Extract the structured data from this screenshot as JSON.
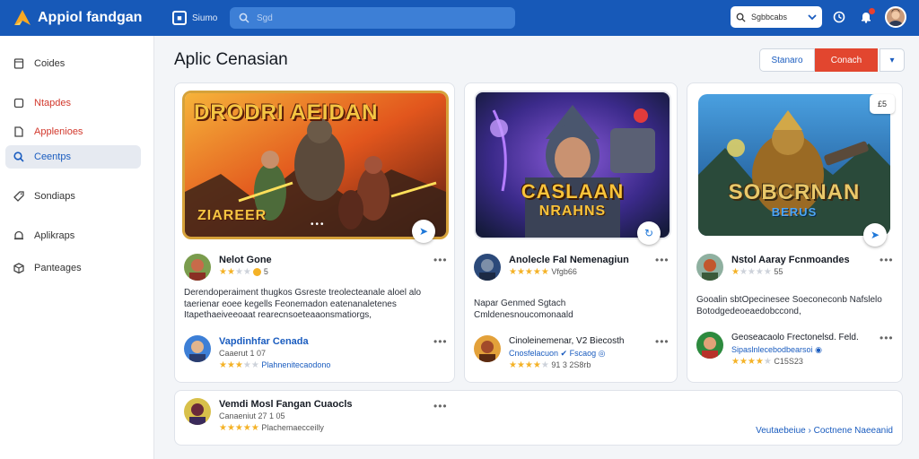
{
  "header": {
    "app_title": "Appiol fandgan",
    "switch_label": "Siumo",
    "search_placeholder": "Sgd",
    "select_label": "Sgbbcabs",
    "colors": {
      "bar": "#1759b8",
      "accent": "#e2462f",
      "link": "#1a5cbf"
    }
  },
  "sidebar": {
    "items": [
      {
        "label": "Coides",
        "icon": "bookmark-icon"
      },
      {
        "label": "Ntapdes",
        "icon": "square-icon"
      },
      {
        "label": "Applenioes",
        "icon": "file-icon"
      },
      {
        "label": "Ceentps",
        "icon": "search-icon"
      },
      {
        "label": "Sondiaps",
        "icon": "tag-icon"
      },
      {
        "label": "Aplikraps",
        "icon": "bell-icon"
      },
      {
        "label": "Panteages",
        "icon": "package-icon"
      }
    ]
  },
  "main": {
    "title": "Aplic Cenasian",
    "buttons": {
      "primary": "Stanaro",
      "accent": "Conach",
      "caret": "▾"
    },
    "cards": [
      {
        "thumb_title_top": "DRODRI AEIDAN",
        "thumb_title_bottom": "ZIAREER",
        "author": "Nelot Gone",
        "rating": 2,
        "desc": [
          "Derendoperaiment thugkos Gsreste treolecteanale aloel alo",
          "taerienar eoee kegells Feonemadon eatenanaletenes",
          "Itapethaeiveeoaat rearecnsoeteaaonsmatiorgs,"
        ],
        "reviewer": "Vapdinhfar Cenada",
        "reviewer_sub": "Caaerut 1  07",
        "reviewer_stars": 3,
        "reviewer_link": "Plahnenitecaodono"
      },
      {
        "thumb_title_top": "CASLAAN",
        "thumb_title_bottom": "NRAHNS",
        "author": "Anolecle Fal Nemenagiun",
        "rating": 5,
        "rating_text": "Vfgb66",
        "desc": [
          "Napar Genmed Sgtach",
          "Cmldenesnoucomonaald"
        ],
        "reviewer": "Cinoleinemenar, V2 Biecosth",
        "reviewer_sub": "Cnosfelacuon ✔ Fscaog ◎",
        "reviewer_stars": 4,
        "reviewer_link": "91 3 2S8rb"
      },
      {
        "thumb_title_top": "SOBCRNAN",
        "thumb_title_bottom": "BERUS",
        "corner_badge": "£5",
        "author": "Nstol Aaray Fcnmoandes",
        "rating": 1,
        "rating_text": "55",
        "desc": [
          "Gooalin sbtOpecinesee  Soeconeconb Nafslelo",
          "Botodgedeoeaedobccond,"
        ],
        "reviewer": "Geoseacaolo Frectonelsd. Feld.",
        "reviewer_sub": "Sipaslnlecebodbearsoi ◉",
        "reviewer_stars": 4,
        "reviewer_link": "C15S23"
      }
    ],
    "wide_card": {
      "author": "Vemdi Mosl Fangan Cuaocls",
      "sub": "Canaeniut  27 1  05",
      "stars": 5,
      "link": "Plachemaecceilly",
      "footer": "Veutaebeiue  › Coctnene Naeeanid"
    }
  }
}
